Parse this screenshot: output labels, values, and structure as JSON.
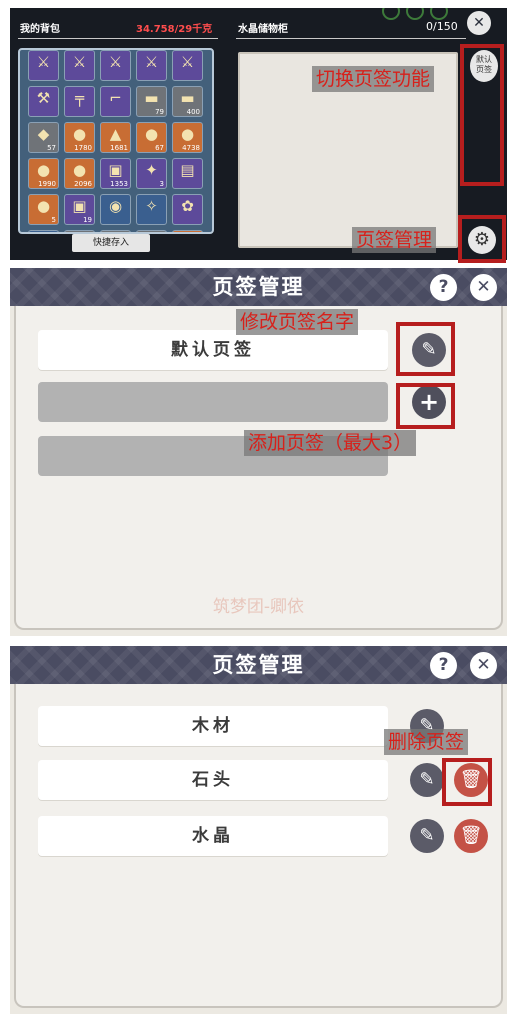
{
  "inventory": {
    "backpack_label": "我的背包",
    "weight": "34.758/29千克",
    "storage_label": "水晶储物柜",
    "storage_count": "0/150",
    "quick_store_label": "快捷存入",
    "tab_default_label": "默认页签",
    "slots": [
      {
        "color": "purple",
        "icon": "weapon-icon",
        "qty": ""
      },
      {
        "color": "purple",
        "icon": "weapon-icon",
        "qty": ""
      },
      {
        "color": "purple",
        "icon": "weapon-icon",
        "qty": ""
      },
      {
        "color": "purple",
        "icon": "weapon-icon",
        "qty": ""
      },
      {
        "color": "purple",
        "icon": "weapon-icon",
        "qty": ""
      },
      {
        "color": "purple",
        "icon": "tool-icon",
        "qty": ""
      },
      {
        "color": "purple",
        "icon": "rifle-icon",
        "qty": ""
      },
      {
        "color": "purple",
        "icon": "gun-icon",
        "qty": ""
      },
      {
        "color": "gray",
        "icon": "wood-log-icon",
        "qty": "79"
      },
      {
        "color": "gray",
        "icon": "wood-log-icon",
        "qty": "400"
      },
      {
        "color": "gray",
        "icon": "leather-icon",
        "qty": "57"
      },
      {
        "color": "orange",
        "icon": "coin-icon",
        "qty": "1780"
      },
      {
        "color": "orange",
        "icon": "armor-icon",
        "qty": "1681"
      },
      {
        "color": "orange",
        "icon": "coin-icon",
        "qty": "67"
      },
      {
        "color": "orange",
        "icon": "coin-icon",
        "qty": "4738"
      },
      {
        "color": "orange",
        "icon": "coin-icon",
        "qty": "1990"
      },
      {
        "color": "orange",
        "icon": "coin-icon",
        "qty": "2096"
      },
      {
        "color": "purple",
        "icon": "crate-icon",
        "qty": "1353"
      },
      {
        "color": "purple",
        "icon": "gem-icon",
        "qty": "3"
      },
      {
        "color": "purple",
        "icon": "card-icon",
        "qty": ""
      },
      {
        "color": "orange",
        "icon": "coin-icon",
        "qty": "5"
      },
      {
        "color": "purple",
        "icon": "crate-icon",
        "qty": "19"
      },
      {
        "color": "blue",
        "icon": "creature-icon",
        "qty": ""
      },
      {
        "color": "blue",
        "icon": "bird-icon",
        "qty": ""
      },
      {
        "color": "purple",
        "icon": "fox-icon",
        "qty": ""
      },
      {
        "color": "blue",
        "icon": "misc-icon",
        "qty": ""
      },
      {
        "color": "gray",
        "icon": "misc-icon",
        "qty": ""
      },
      {
        "color": "gray",
        "icon": "misc-icon",
        "qty": ""
      },
      {
        "color": "gray",
        "icon": "misc-icon",
        "qty": ""
      },
      {
        "color": "orange",
        "icon": "misc-icon",
        "qty": ""
      }
    ]
  },
  "annotations": {
    "tab_switch": "切换页签功能",
    "tab_manage": "页签管理",
    "rename_tab": "修改页签名字",
    "add_tab": "添加页签（最大3）",
    "delete_tab": "删除页签"
  },
  "manage_panel_1": {
    "title": "页签管理",
    "tabs": [
      "默认页签"
    ],
    "watermark": "筑梦团-卿依"
  },
  "manage_panel_2": {
    "title": "页签管理",
    "tabs": [
      "木材",
      "石头",
      "水晶"
    ]
  },
  "icons": {
    "help": "?",
    "close": "✕",
    "edit": "✎",
    "add": "+",
    "delete": "🗑",
    "gear": "⚙"
  },
  "colors": {
    "annotation_red": "#d7211b",
    "box_red": "#b61e1e",
    "header": "#4a4c62",
    "weight_red": "#ff4d4d"
  }
}
